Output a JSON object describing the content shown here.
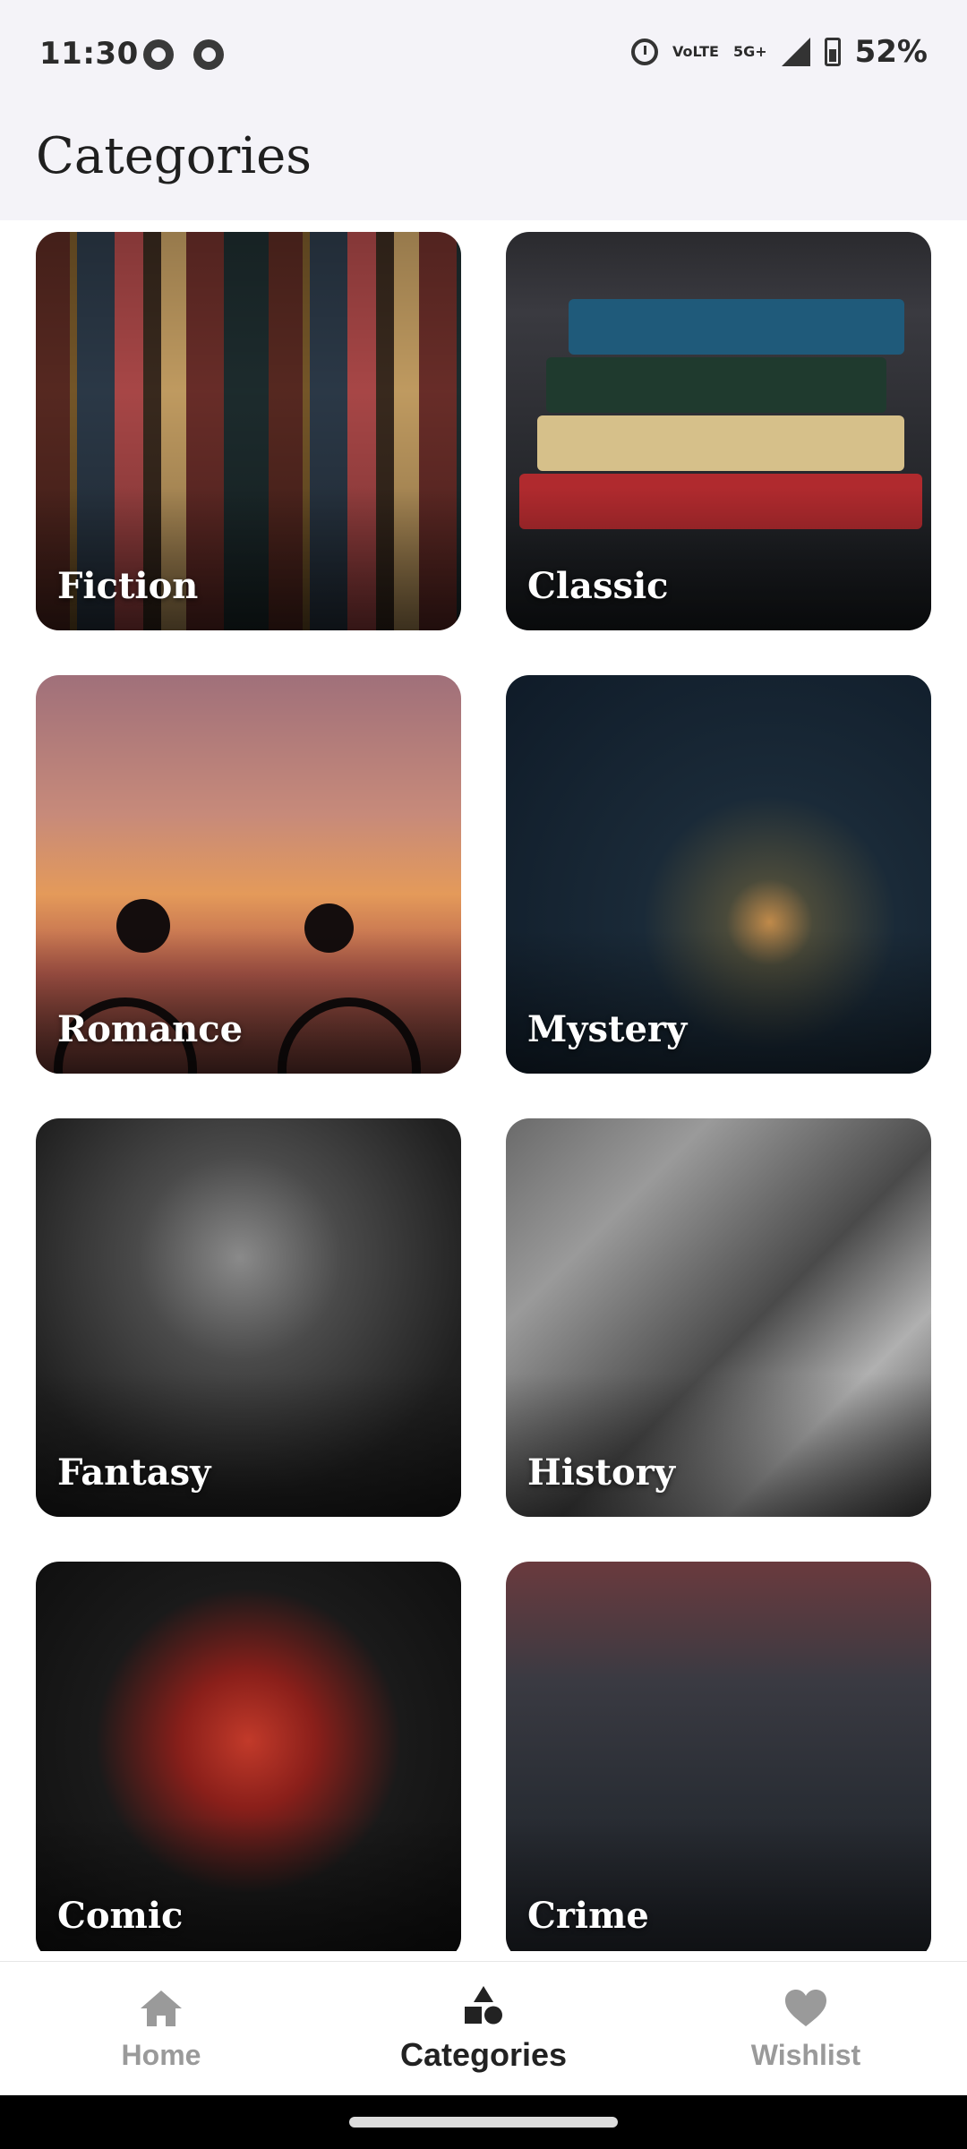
{
  "status_bar": {
    "time": "11:30",
    "network": "5G+",
    "volte": "VoLTE",
    "battery": "52%"
  },
  "header": {
    "title": "Categories"
  },
  "categories": [
    {
      "label": "Fiction"
    },
    {
      "label": "Classic"
    },
    {
      "label": "Romance"
    },
    {
      "label": "Mystery"
    },
    {
      "label": "Fantasy"
    },
    {
      "label": "History"
    },
    {
      "label": "Comic"
    },
    {
      "label": "Crime"
    }
  ],
  "bottom_nav": {
    "items": [
      {
        "label": "Home",
        "icon": "home-icon",
        "active": false
      },
      {
        "label": "Categories",
        "icon": "categories-icon",
        "active": true
      },
      {
        "label": "Wishlist",
        "icon": "heart-icon",
        "active": false
      }
    ]
  },
  "colors": {
    "active": "#222222",
    "inactive": "#9a9a9a",
    "header_bg": "#f4f3f8"
  }
}
